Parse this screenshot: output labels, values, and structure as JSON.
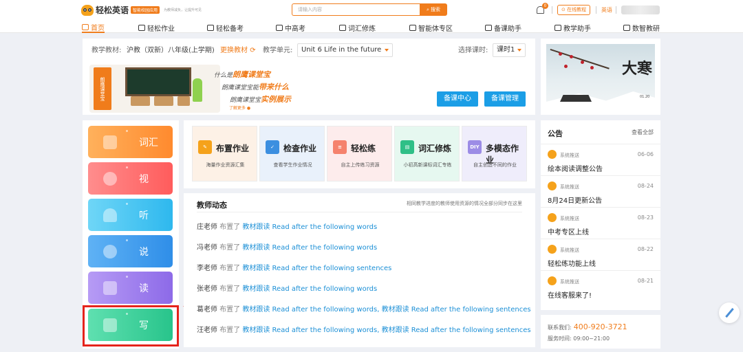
{
  "header": {
    "brand": "轻松英语",
    "badge": "智能校园应用",
    "slogan": "为教师减负，让提升可见",
    "search_placeholder": "请输入内容",
    "search_button": "搜索",
    "notification_count": "0",
    "online_button": "在线教程",
    "lang": "英语"
  },
  "nav": [
    {
      "label": "首页"
    },
    {
      "label": "轻松作业"
    },
    {
      "label": "轻松备考"
    },
    {
      "label": "中高考"
    },
    {
      "label": "词汇修炼"
    },
    {
      "label": "智能体专区"
    },
    {
      "label": "备课助手"
    },
    {
      "label": "教学助手"
    },
    {
      "label": "数智教研"
    }
  ],
  "hero": {
    "material_label": "教学教材:",
    "material_value": "沪教（双新）八年级(上学期)",
    "switch_material": "更换教材",
    "unit_label": "教学单元:",
    "unit_value": "Unit 6 Life in the future",
    "lesson_label": "选择课时:",
    "lesson_value": "课时1",
    "illustration_badge": "朗鹰课堂宝",
    "caption1_prefix": "什么是",
    "caption1_bold": "朗鹰课堂宝",
    "caption2_prefix": "朗鹰课堂宝能",
    "caption2_bold": "带来什么",
    "caption3_prefix": "朗鹰课堂宝",
    "caption3_bold": "实例展示",
    "more": "了解更多",
    "btn_prep_center": "备课中心",
    "btn_prep_manage": "备课管理"
  },
  "banner": {
    "title": "大寒",
    "date": "01.20"
  },
  "skills": [
    {
      "label": "词汇",
      "color_from": "#ffb15c",
      "color_to": "#ff8a2e"
    },
    {
      "label": "视",
      "color_from": "#ff8d8d",
      "color_to": "#ff5c5c"
    },
    {
      "label": "听",
      "color_from": "#6fd6f7",
      "color_to": "#2eb8ee"
    },
    {
      "label": "说",
      "color_from": "#5fb2f5",
      "color_to": "#2f8ee8"
    },
    {
      "label": "读",
      "color_from": "#b69bf5",
      "color_to": "#8d6ae8"
    },
    {
      "label": "写",
      "color_from": "#5fe0b0",
      "color_to": "#28c48b"
    }
  ],
  "quick_cards": [
    {
      "title": "布置作业",
      "sub": "海量作业资源汇集",
      "icon": "edit-icon",
      "bg": "#fdf1e6",
      "ico_color": "#f5a21b",
      "ico_text": "✎"
    },
    {
      "title": "检查作业",
      "sub": "查看学生作业情况",
      "icon": "check-icon",
      "bg": "#e9f1fb",
      "ico_color": "#3c8fe0",
      "ico_text": "✓"
    },
    {
      "title": "轻松练",
      "sub": "自主上传练习资源",
      "icon": "practice-icon",
      "bg": "#fdecec",
      "ico_color": "#f5826d",
      "ico_text": "≡"
    },
    {
      "title": "词汇修炼",
      "sub": "小初高新课标词汇专练",
      "icon": "vocab-icon",
      "bg": "#e6f8f0",
      "ico_color": "#2fbf87",
      "ico_text": "▤"
    },
    {
      "title": "多模态作业",
      "sub": "自主创造不同的作业",
      "icon": "diy-icon",
      "bg": "#efedfb",
      "ico_color": "#9c8ce6",
      "ico_text": "DIY"
    }
  ],
  "dynamics": {
    "title": "教师动态",
    "note": "相同教学进度的教师使用资源的情况全部分同步在这里",
    "rows": [
      {
        "teacher": "庄老师",
        "verb": "布置了",
        "content": "教材跟读 Read after the following words"
      },
      {
        "teacher": "冯老师",
        "verb": "布置了",
        "content": "教材跟读 Read after the following words"
      },
      {
        "teacher": "李老师",
        "verb": "布置了",
        "content": "教材跟读 Read after the following sentences"
      },
      {
        "teacher": "张老师",
        "verb": "布置了",
        "content": "教材跟读 Read after the following words"
      },
      {
        "teacher": "葛老师",
        "verb": "布置了",
        "content": "教材跟读 Read after the following words, 教材跟读 Read after the following sentences"
      },
      {
        "teacher": "汪老师",
        "verb": "布置了",
        "content": "教材跟读 Read after the following words, 教材跟读 Read after the following sentences"
      }
    ]
  },
  "notice": {
    "title": "公告",
    "view_all": "查看全部",
    "items": [
      {
        "source": "系统推送",
        "date": "06-06",
        "text": "绘本阅读调整公告"
      },
      {
        "source": "系统推送",
        "date": "08-24",
        "text": "8月24日更新公告"
      },
      {
        "source": "系统推送",
        "date": "08-23",
        "text": "中考专区上线"
      },
      {
        "source": "系统推送",
        "date": "08-22",
        "text": "轻松练功能上线"
      },
      {
        "source": "系统推送",
        "date": "08-21",
        "text": "在线客服来了!"
      }
    ]
  },
  "contact": {
    "label": "联系我们:",
    "phone": "400-920-3721",
    "hours": "服务时间: 09:00~21:00"
  },
  "colors": {
    "accent": "#f07c1b",
    "link": "#1b8fd6",
    "highlight": "#e5231b"
  }
}
